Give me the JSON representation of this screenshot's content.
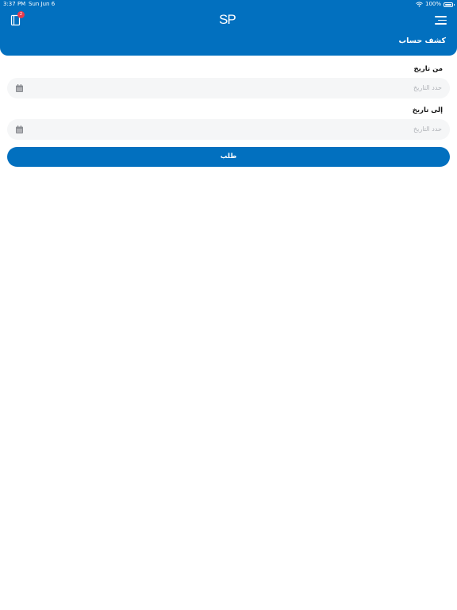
{
  "status_bar": {
    "time": "3:37 PM",
    "date": "Sun Jun 6",
    "battery": "100%"
  },
  "header": {
    "logo_text": "SP",
    "cart_badge": "2",
    "title": "كشف حساب"
  },
  "form": {
    "from_label": "من تاريخ",
    "from_placeholder": "حدد التاريخ",
    "to_label": "إلى تاريخ",
    "to_placeholder": "حدد التاريخ",
    "submit_label": "طلب"
  },
  "icons": {
    "cart": "cart-icon",
    "menu": "menu-icon",
    "calendar": "calendar-icon",
    "wifi": "wifi-icon",
    "battery": "battery-icon"
  },
  "colors": {
    "primary": "#0270bf",
    "badge": "#e53b4e",
    "field_bg": "#f5f6f7",
    "placeholder": "#b0b3b8"
  }
}
